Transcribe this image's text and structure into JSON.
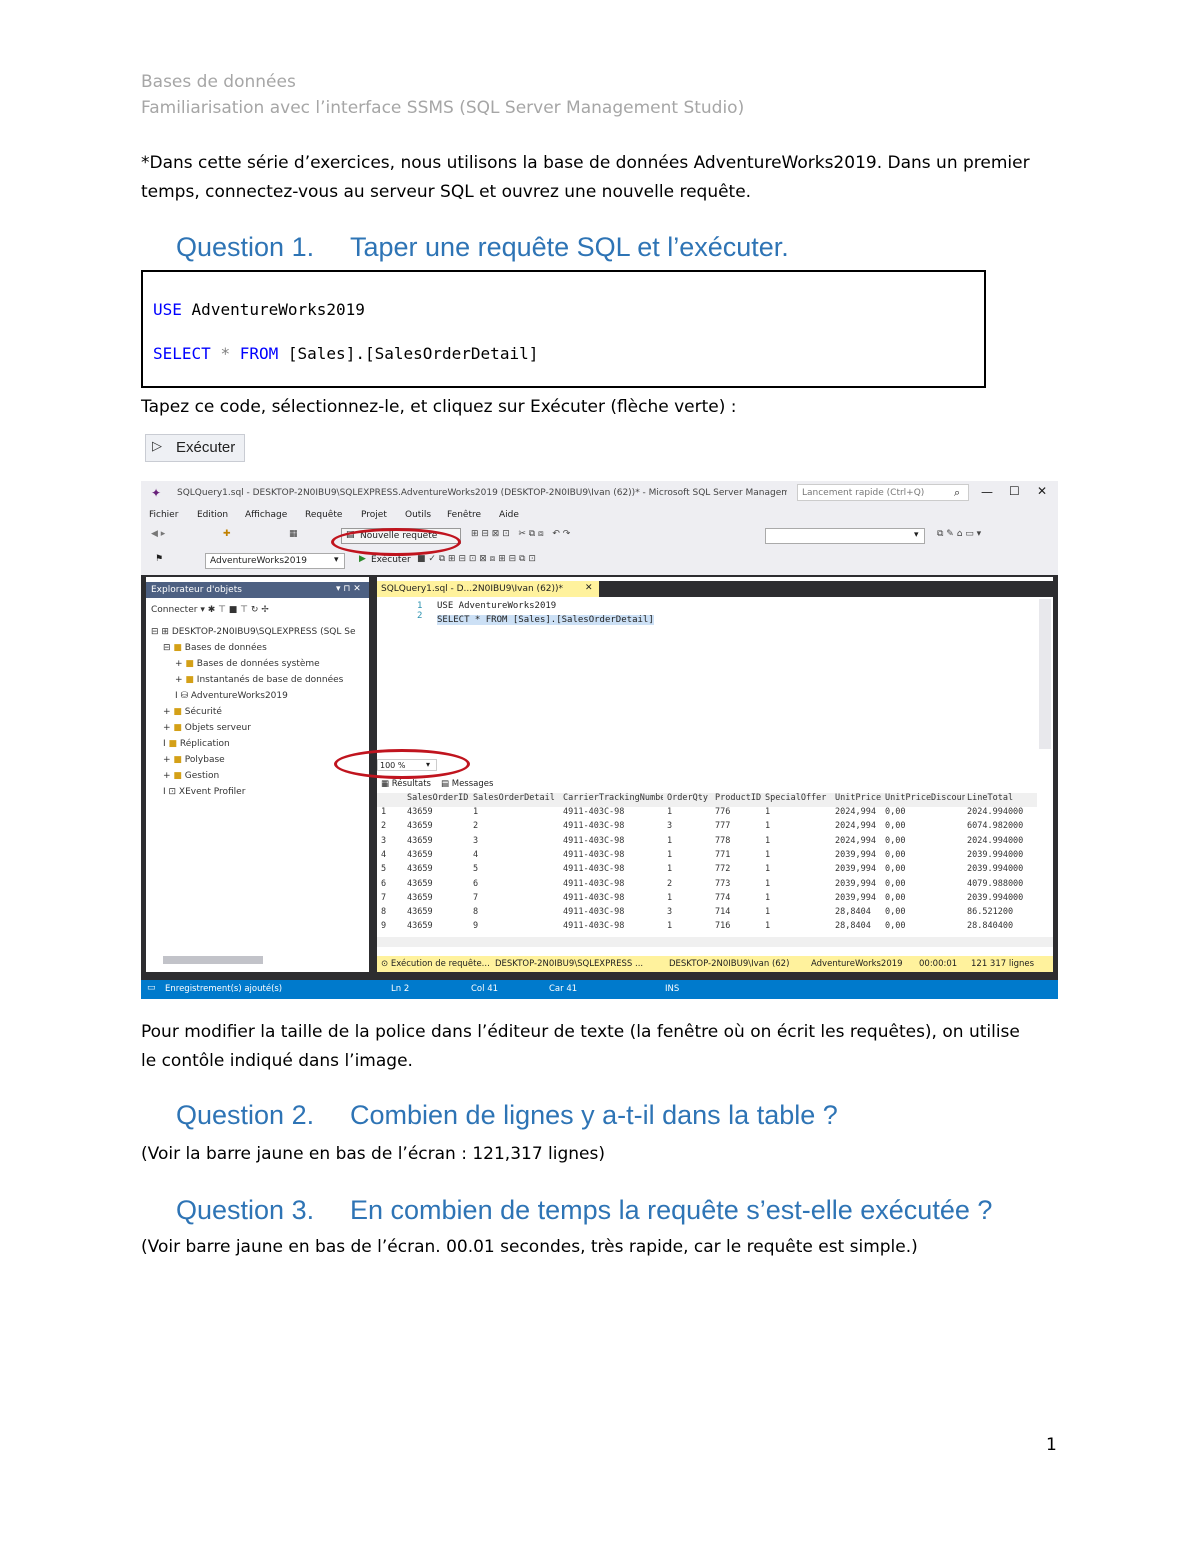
{
  "header": {
    "line1": "Bases de données",
    "line2": "Familiarisation avec l’interface SSMS (SQL Server Management Studio)"
  },
  "intro": {
    "line1": "*Dans cette série d’exercices, nous utilisons la base de données AdventureWorks2019. Dans un premier",
    "line2": "temps, connectez-vous au serveur SQL et ouvrez une nouvelle requête."
  },
  "q1": {
    "number": "Question 1.",
    "title": "Taper une requête SQL et l’exécuter."
  },
  "code": {
    "l1_kw": "USE",
    "l1_rest": "AdventureWorks2019",
    "l2_kw1": "SELECT",
    "l2_star": "*",
    "l2_kw2": "FROM",
    "l2_rest": "[Sales].[SalesOrderDetail]"
  },
  "instr": "Tapez ce code, sélectionnez-le, et cliquez sur Exécuter (flèche verte) :",
  "exec_button": "Exécuter",
  "ssms": {
    "title": "SQLQuery1.sql - DESKTOP-2N0IBU9\\SQLEXPRESS.AdventureWorks2019 (DESKTOP-2N0IBU9\\Ivan (62))* - Microsoft SQL Server Management Studio",
    "search_placeholder": "Lancement rapide (Ctrl+Q)",
    "menu": [
      "Fichier",
      "Edition",
      "Affichage",
      "Requête",
      "Projet",
      "Outils",
      "Fenêtre",
      "Aide"
    ],
    "new_query": "Nouvelle requête",
    "db_select": "AdventureWorks2019",
    "execute": "Exécuter",
    "obj_explorer_title": "Explorateur d'objets",
    "connect": "Connecter",
    "tree": [
      "DESKTOP-2N0IBU9\\SQLEXPRESS (SQL Se",
      "Bases de données",
      "Bases de données système",
      "Instantanés de base de données",
      "AdventureWorks2019",
      "Sécurité",
      "Objets serveur",
      "Réplication",
      "Polybase",
      "Gestion",
      "XEvent Profiler"
    ],
    "tab": "SQLQuery1.sql - D...2N0IBU9\\Ivan (62))*",
    "editor_l1": "USE AdventureWorks2019",
    "editor_l2": "SELECT * FROM [Sales].[SalesOrderDetail]",
    "zoom": "100 %",
    "results_tab": "Résultats",
    "messages_tab": "Messages",
    "columns": [
      "SalesOrderID",
      "SalesOrderDetailID",
      "CarrierTrackingNumber",
      "OrderQty",
      "ProductID",
      "SpecialOfferID",
      "UnitPrice",
      "UnitPriceDiscount",
      "LineTotal"
    ],
    "rows": [
      [
        "1",
        "43659",
        "1",
        "4911-403C-98",
        "1",
        "776",
        "1",
        "2024,994",
        "0,00",
        "2024.994000"
      ],
      [
        "2",
        "43659",
        "2",
        "4911-403C-98",
        "3",
        "777",
        "1",
        "2024,994",
        "0,00",
        "6074.982000"
      ],
      [
        "3",
        "43659",
        "3",
        "4911-403C-98",
        "1",
        "778",
        "1",
        "2024,994",
        "0,00",
        "2024.994000"
      ],
      [
        "4",
        "43659",
        "4",
        "4911-403C-98",
        "1",
        "771",
        "1",
        "2039,994",
        "0,00",
        "2039.994000"
      ],
      [
        "5",
        "43659",
        "5",
        "4911-403C-98",
        "1",
        "772",
        "1",
        "2039,994",
        "0,00",
        "2039.994000"
      ],
      [
        "6",
        "43659",
        "6",
        "4911-403C-98",
        "2",
        "773",
        "1",
        "2039,994",
        "0,00",
        "4079.988000"
      ],
      [
        "7",
        "43659",
        "7",
        "4911-403C-98",
        "1",
        "774",
        "1",
        "2039,994",
        "0,00",
        "2039.994000"
      ],
      [
        "8",
        "43659",
        "8",
        "4911-403C-98",
        "3",
        "714",
        "1",
        "28,8404",
        "0,00",
        "86.521200"
      ],
      [
        "9",
        "43659",
        "9",
        "4911-403C-98",
        "1",
        "716",
        "1",
        "28,8404",
        "0,00",
        "28.840400"
      ]
    ],
    "status_exec": "Exécution de requête...",
    "status_server": "DESKTOP-2N0IBU9\\SQLEXPRESS ...",
    "status_user": "DESKTOP-2N0IBU9\\Ivan (62)",
    "status_db": "AdventureWorks2019",
    "status_time": "00:00:01",
    "status_rows": "121 317 lignes",
    "bottom_status": "Enregistrement(s) ajouté(s)",
    "ln": "Ln 2",
    "col": "Col 41",
    "car": "Car 41",
    "ins": "INS"
  },
  "after_img": {
    "line1": "Pour modifier la taille de la police dans l’éditeur de texte (la fenêtre où on écrit les requêtes), on utilise",
    "line2": "le contôle indiqué dans l’image."
  },
  "q2": {
    "number": "Question 2.",
    "title": "Combien de lignes y a-t-il dans la table ?"
  },
  "a2": "(Voir la barre jaune en bas de l’écran : 121,317 lignes)",
  "q3": {
    "number": "Question 3.",
    "title": "En combien de temps la requête s’est-elle exécutée ?"
  },
  "a3": "(Voir barre jaune en bas de l’écran. 00.01 secondes, très rapide, car le requête est simple.)",
  "page_number": "1"
}
